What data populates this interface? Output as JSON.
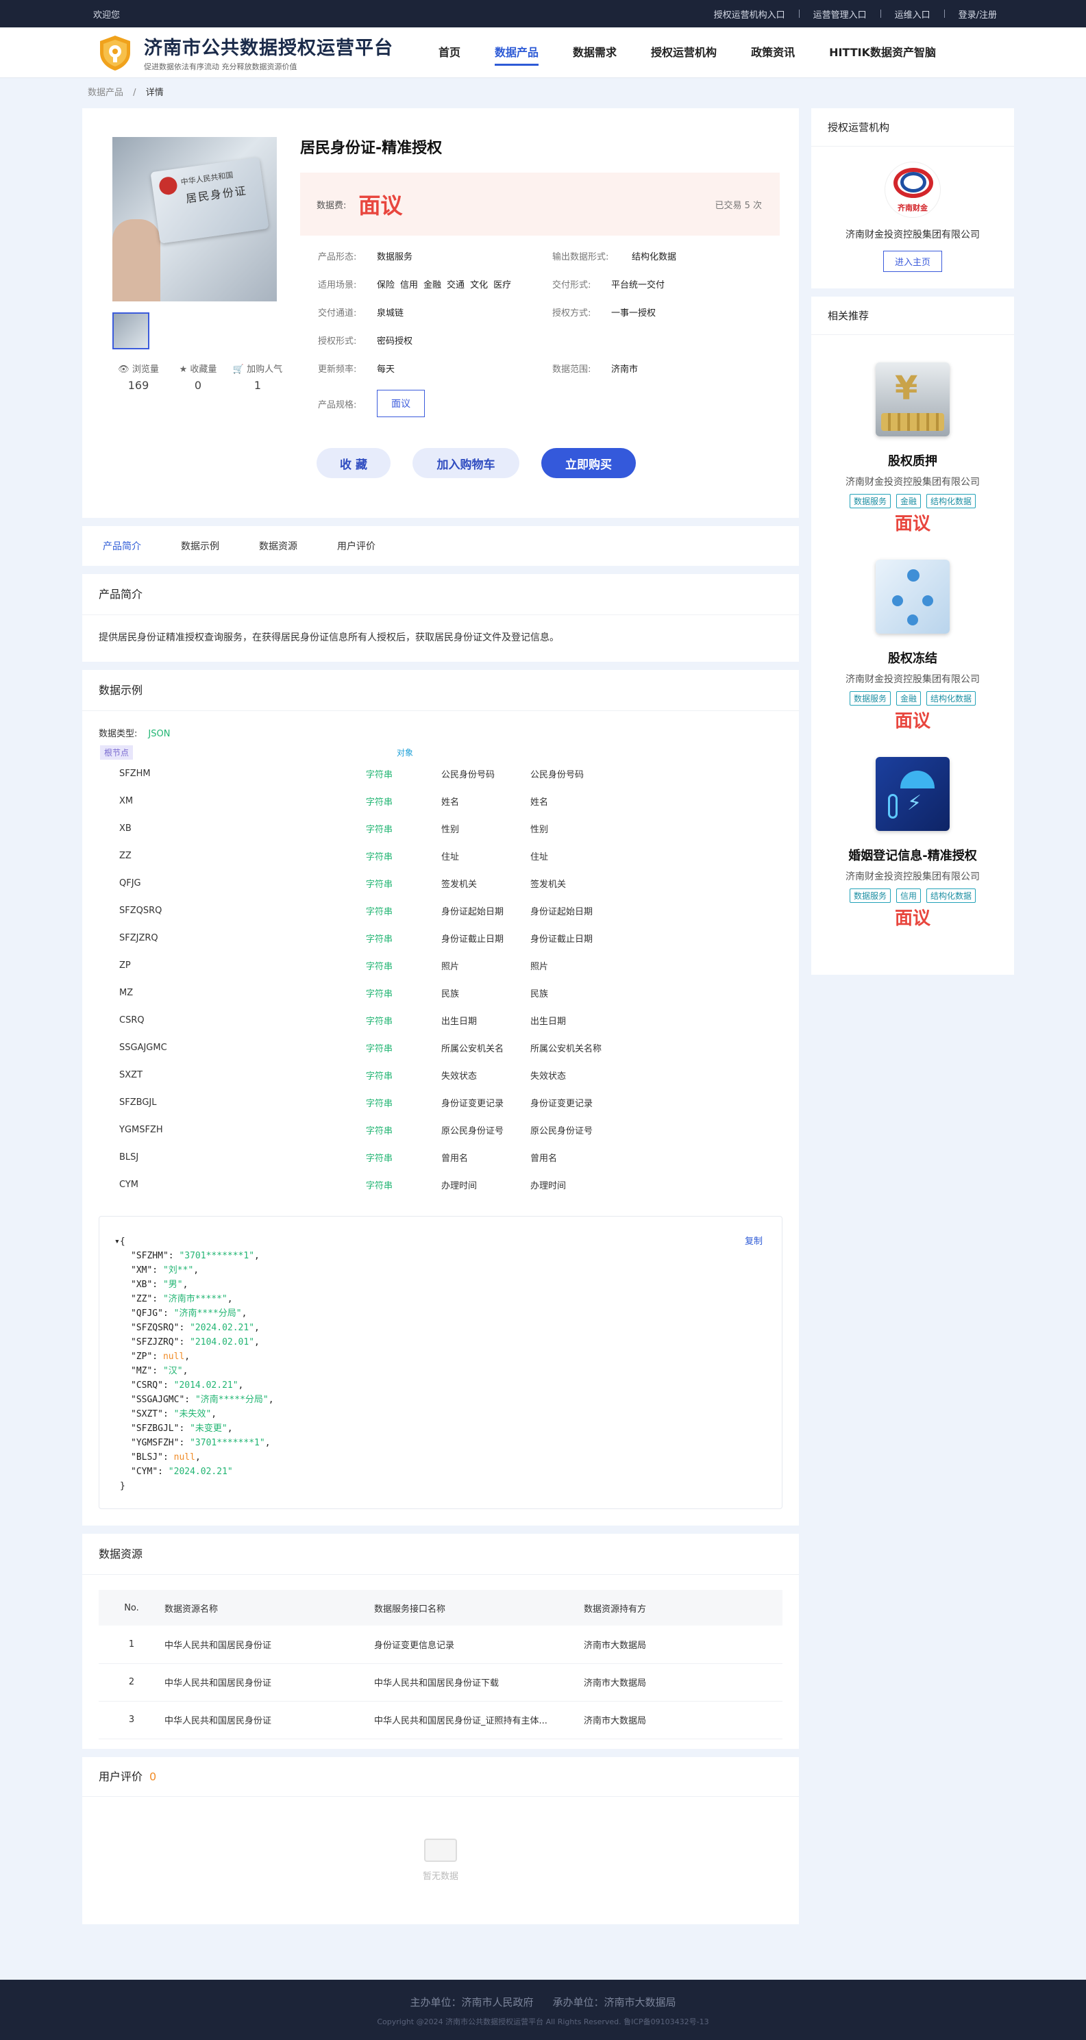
{
  "topbar": {
    "welcome": "欢迎您",
    "links": [
      "授权运营机构入口",
      "运营管理入口",
      "运维入口",
      "登录/注册"
    ]
  },
  "header": {
    "title": "济南市公共数据授权运营平台",
    "subtitle": "促进数据依法有序流动 充分释放数据资源价值",
    "nav": [
      "首页",
      "数据产品",
      "数据需求",
      "授权运营机构",
      "政策资讯",
      "HITTIK数据资产智脑"
    ],
    "nav_active": 1
  },
  "breadcrumb": {
    "root": "数据产品",
    "current": "详情"
  },
  "product": {
    "title": "居民身份证-精准授权",
    "card_text1": "中华人民共和国",
    "card_text2": "居民身份证",
    "price_label": "数据费:",
    "price": "面议",
    "deal_count": "已交易 5 次",
    "stats": [
      {
        "label": "浏览量",
        "value": "169"
      },
      {
        "label": "收藏量",
        "value": "0"
      },
      {
        "label": "加购人气",
        "value": "1"
      }
    ],
    "specs": {
      "form_label": "产品形态:",
      "form": "数据服务",
      "output_label": "输出数据形式:",
      "output": "结构化数据",
      "scene_label": "适用场景:",
      "scenes": [
        "保险",
        "信用",
        "金融",
        "交通",
        "文化",
        "医疗"
      ],
      "delivery_label": "交付形式:",
      "delivery": "平台统一交付",
      "channel_label": "交付通道:",
      "channel": "泉城链",
      "auth_label": "授权方式:",
      "auth": "一事一授权",
      "auth_form_label": "授权形式:",
      "auth_form": "密码授权",
      "freq_label": "更新频率:",
      "freq": "每天",
      "range_label": "数据范围:",
      "range": "济南市",
      "spec_label": "产品规格:",
      "spec": "面议"
    },
    "actions": {
      "favorite": "收 藏",
      "cart": "加入购物车",
      "buy": "立即购买"
    }
  },
  "tabs": [
    "产品简介",
    "数据示例",
    "数据资源",
    "用户评价"
  ],
  "intro": {
    "heading": "产品简介",
    "text": "提供居民身份证精准授权查询服务，在获得居民身份证信息所有人授权后，获取居民身份证文件及登记信息。"
  },
  "sample": {
    "heading": "数据示例",
    "type_label": "数据类型:",
    "type": "JSON",
    "root_label": "根节点",
    "object_label": "对象",
    "fields": [
      {
        "key": "SFZHM",
        "type": "字符串",
        "name": "公民身份号码",
        "desc": "公民身份号码"
      },
      {
        "key": "XM",
        "type": "字符串",
        "name": "姓名",
        "desc": "姓名"
      },
      {
        "key": "XB",
        "type": "字符串",
        "name": "性别",
        "desc": "性别"
      },
      {
        "key": "ZZ",
        "type": "字符串",
        "name": "住址",
        "desc": "住址"
      },
      {
        "key": "QFJG",
        "type": "字符串",
        "name": "签发机关",
        "desc": "签发机关"
      },
      {
        "key": "SFZQSRQ",
        "type": "字符串",
        "name": "身份证起始日期",
        "desc": "身份证起始日期"
      },
      {
        "key": "SFZJZRQ",
        "type": "字符串",
        "name": "身份证截止日期",
        "desc": "身份证截止日期"
      },
      {
        "key": "ZP",
        "type": "字符串",
        "name": "照片",
        "desc": "照片"
      },
      {
        "key": "MZ",
        "type": "字符串",
        "name": "民族",
        "desc": "民族"
      },
      {
        "key": "CSRQ",
        "type": "字符串",
        "name": "出生日期",
        "desc": "出生日期"
      },
      {
        "key": "SSGAJGMC",
        "type": "字符串",
        "name": "所属公安机关名",
        "desc": "所属公安机关名称"
      },
      {
        "key": "SXZT",
        "type": "字符串",
        "name": "失效状态",
        "desc": "失效状态"
      },
      {
        "key": "SFZBGJL",
        "type": "字符串",
        "name": "身份证变更记录",
        "desc": "身份证变更记录"
      },
      {
        "key": "YGMSFZH",
        "type": "字符串",
        "name": "原公民身份证号",
        "desc": "原公民身份证号"
      },
      {
        "key": "BLSJ",
        "type": "字符串",
        "name": "曾用名",
        "desc": "曾用名"
      },
      {
        "key": "CYM",
        "type": "字符串",
        "name": "办理时间",
        "desc": "办理时间"
      }
    ],
    "copy_label": "复制",
    "json_lines": [
      {
        "k": "SFZHM",
        "v": "\"3701*******1\"",
        "null": false
      },
      {
        "k": "XM",
        "v": "\"刘**\"",
        "null": false
      },
      {
        "k": "XB",
        "v": "\"男\"",
        "null": false
      },
      {
        "k": "ZZ",
        "v": "\"济南市*****\"",
        "null": false
      },
      {
        "k": "QFJG",
        "v": "\"济南****分局\"",
        "null": false
      },
      {
        "k": "SFZQSRQ",
        "v": "\"2024.02.21\"",
        "null": false
      },
      {
        "k": "SFZJZRQ",
        "v": "\"2104.02.01\"",
        "null": false
      },
      {
        "k": "ZP",
        "v": "null",
        "null": true
      },
      {
        "k": "MZ",
        "v": "\"汉\"",
        "null": false
      },
      {
        "k": "CSRQ",
        "v": "\"2014.02.21\"",
        "null": false
      },
      {
        "k": "SSGAJGMC",
        "v": "\"济南*****分局\"",
        "null": false
      },
      {
        "k": "SXZT",
        "v": "\"未失效\"",
        "null": false
      },
      {
        "k": "SFZBGJL",
        "v": "\"未变更\"",
        "null": false
      },
      {
        "k": "YGMSFZH",
        "v": "\"3701*******1\"",
        "null": false
      },
      {
        "k": "BLSJ",
        "v": "null",
        "null": true
      },
      {
        "k": "CYM",
        "v": "\"2024.02.21\"",
        "null": false,
        "last": true
      }
    ]
  },
  "resources": {
    "heading": "数据资源",
    "columns": [
      "No.",
      "数据资源名称",
      "数据服务接口名称",
      "数据资源持有方"
    ],
    "rows": [
      [
        "1",
        "中华人民共和国居民身份证",
        "身份证变更信息记录",
        "济南市大数据局"
      ],
      [
        "2",
        "中华人民共和国居民身份证",
        "中华人民共和国居民身份证下载",
        "济南市大数据局"
      ],
      [
        "3",
        "中华人民共和国居民身份证",
        "中华人民共和国居民身份证_证照持有主体...",
        "济南市大数据局"
      ]
    ]
  },
  "reviews": {
    "heading": "用户评价",
    "count": "0",
    "empty": "暂无数据"
  },
  "sidebar": {
    "org_heading": "授权运营机构",
    "org_logo_text": "齐南财金",
    "org_name": "济南财金投资控股集团有限公司",
    "org_button": "进入主页",
    "rec_heading": "相关推荐",
    "recs": [
      {
        "title": "股权质押",
        "org": "济南财金投资控股集团有限公司",
        "tags": [
          "数据服务",
          "金融",
          "结构化数据"
        ],
        "price": "面议"
      },
      {
        "title": "股权冻结",
        "org": "济南财金投资控股集团有限公司",
        "tags": [
          "数据服务",
          "金融",
          "结构化数据"
        ],
        "price": "面议"
      },
      {
        "title": "婚姻登记信息-精准授权",
        "org": "济南财金投资控股集团有限公司",
        "tags": [
          "数据服务",
          "信用",
          "结构化数据"
        ],
        "price": "面议"
      }
    ]
  },
  "footer": {
    "host": "主办单位：济南市人民政府",
    "organizer": "承办单位：济南市大数据局",
    "copyright": "Copyright @2024 济南市公共数据授权运营平台 All Rights Reserved. 鲁ICP备09103432号-13"
  },
  "colors": {
    "primary": "#3459db",
    "price": "#e8463e",
    "header_bg": "#1c2438",
    "string_green": "#22b573"
  }
}
